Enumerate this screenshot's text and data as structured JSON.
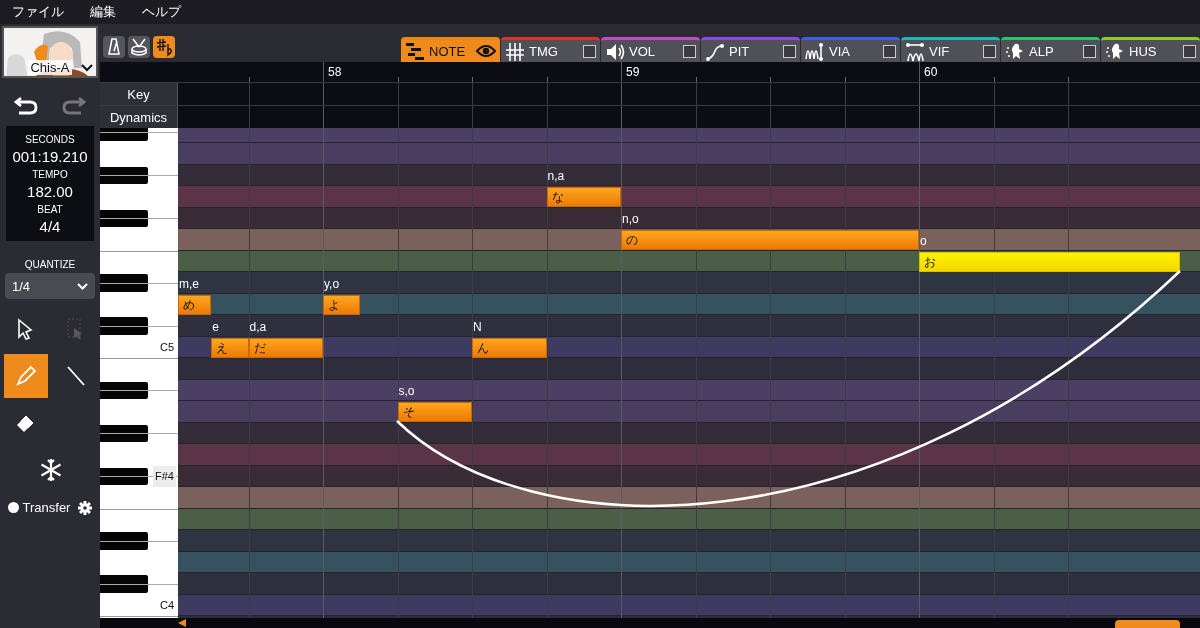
{
  "menu": [
    "ファイル",
    "編集",
    "ヘルプ"
  ],
  "voice": {
    "name": "Chis-A"
  },
  "toolbar_toggles": [
    {
      "on": false
    },
    {
      "on": false
    },
    {
      "on": true
    }
  ],
  "history": [
    {
      "disabled": false
    },
    {
      "disabled": true
    }
  ],
  "info": [
    {
      "label": "SECONDS",
      "value": "001:19.210"
    },
    {
      "label": "TEMPO",
      "value": "182.00"
    },
    {
      "label": "BEAT",
      "value": "4/4"
    }
  ],
  "quantize": {
    "label": "QUANTIZE",
    "value": "1/4"
  },
  "tools": [
    {
      "selected": false,
      "disabled": false
    },
    {
      "selected": false,
      "disabled": true
    },
    {
      "selected": true,
      "disabled": false
    },
    {
      "selected": false,
      "disabled": false
    },
    {
      "selected": false,
      "disabled": false
    },
    {
      "selected": false,
      "disabled": false
    }
  ],
  "transfer": {
    "label": "Transfer",
    "checked": false
  },
  "tabs": [
    {
      "label": "NOTE",
      "selected": true,
      "color": "#f0850f"
    },
    {
      "label": "TMG",
      "selected": false,
      "checked": false,
      "color": "#d9342b"
    },
    {
      "label": "VOL",
      "selected": false,
      "checked": false,
      "color": "#c04cc0"
    },
    {
      "label": "PIT",
      "selected": false,
      "checked": false,
      "color": "#8a4de0"
    },
    {
      "label": "VIA",
      "selected": false,
      "checked": false,
      "color": "#3f5fe0"
    },
    {
      "label": "VIF",
      "selected": false,
      "checked": false,
      "color": "#1fb8b0"
    },
    {
      "label": "ALP",
      "selected": false,
      "checked": false,
      "color": "#2ec26a"
    },
    {
      "label": "HUS",
      "selected": false,
      "checked": false,
      "color": "#8ccc30"
    }
  ],
  "measures": [
    "58",
    "59",
    "60"
  ],
  "track_labels": [
    "Key",
    "Dynamics"
  ],
  "piano_labels": [
    "C5",
    "F#4",
    "C4"
  ],
  "notes": [
    {
      "lyric": "め",
      "phoneme": "m,e",
      "selected": false
    },
    {
      "lyric": "え",
      "phoneme": "e",
      "selected": false
    },
    {
      "lyric": "だ",
      "phoneme": "d,a",
      "selected": false
    },
    {
      "lyric": "よ",
      "phoneme": "y,o",
      "selected": false
    },
    {
      "lyric": "そ",
      "phoneme": "s,o",
      "selected": false
    },
    {
      "lyric": "ん",
      "phoneme": "N",
      "selected": false
    },
    {
      "lyric": "な",
      "phoneme": "n,a",
      "selected": false
    },
    {
      "lyric": "の",
      "phoneme": "n,o",
      "selected": false
    },
    {
      "lyric": "お",
      "phoneme": "o",
      "selected": true
    }
  ]
}
